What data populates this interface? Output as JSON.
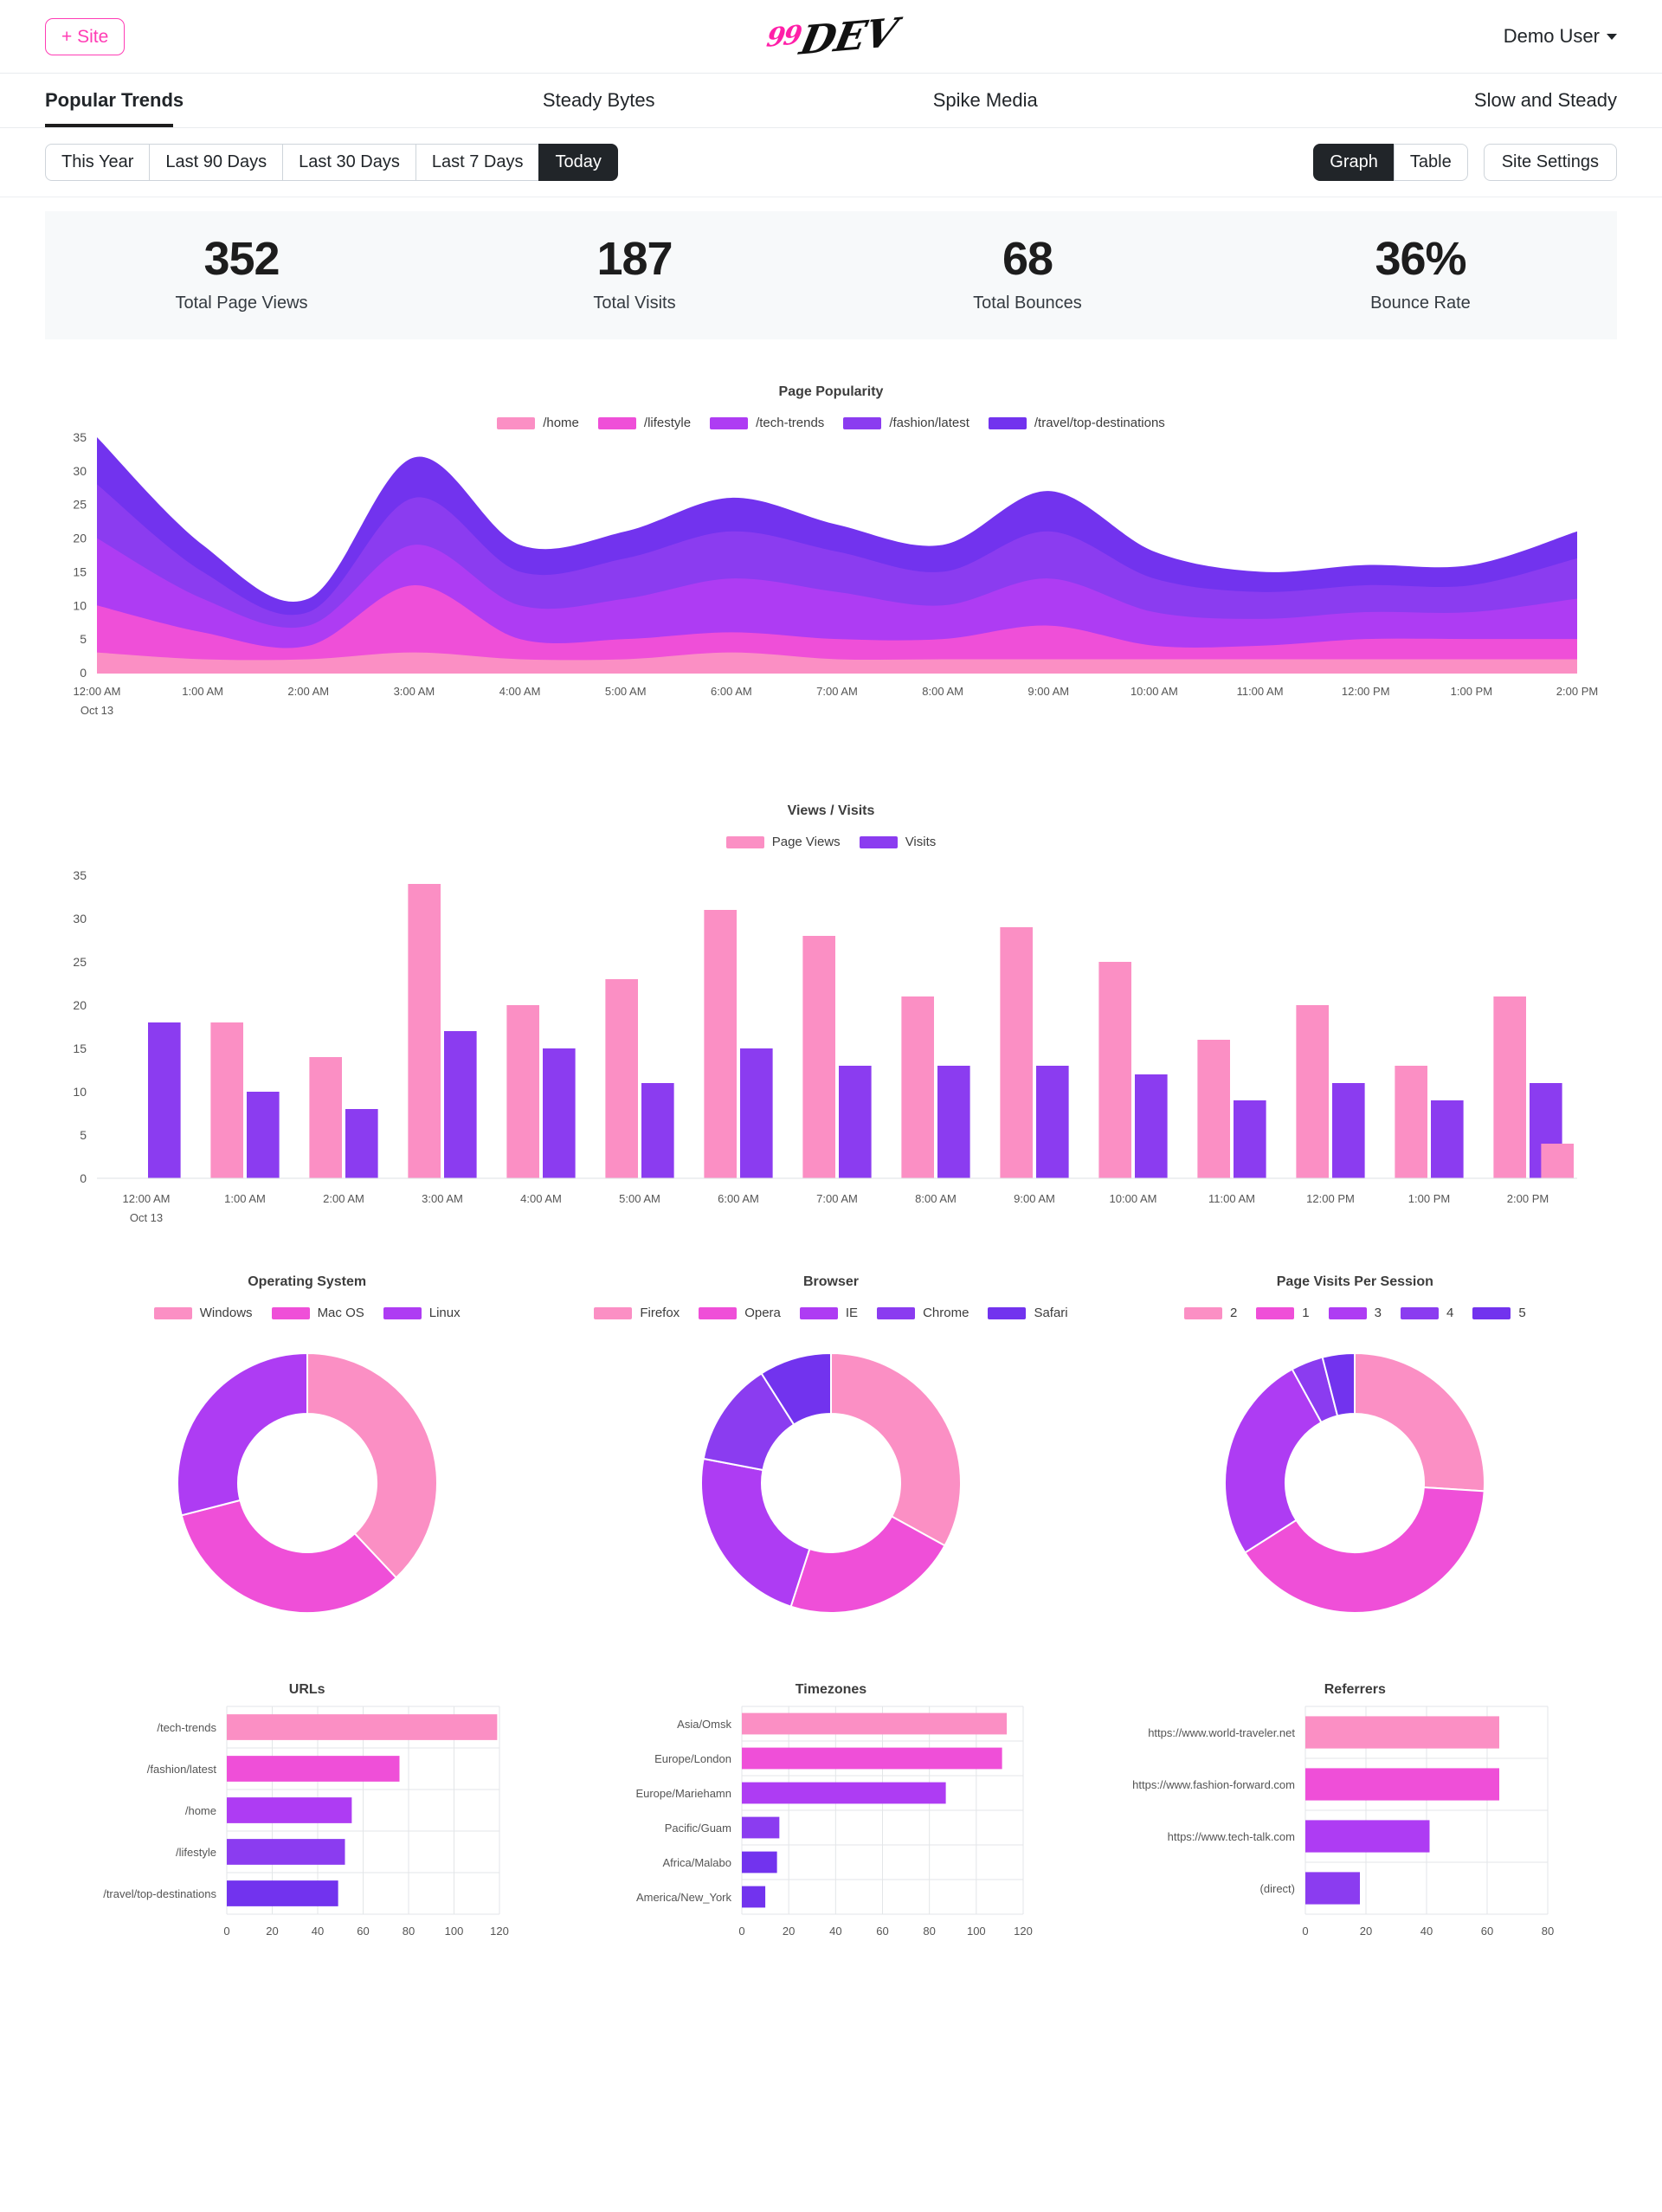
{
  "topbar": {
    "add_site_label": "+ Site",
    "brand_prefix": "99",
    "brand_main": "DEV",
    "user_label": "Demo User"
  },
  "site_tabs": [
    {
      "label": "Popular Trends",
      "active": true
    },
    {
      "label": "Steady Bytes",
      "active": false
    },
    {
      "label": "Spike Media",
      "active": false
    },
    {
      "label": "Slow and Steady",
      "active": false
    }
  ],
  "controls": {
    "ranges": [
      {
        "label": "This Year",
        "active": false
      },
      {
        "label": "Last 90 Days",
        "active": false
      },
      {
        "label": "Last 30 Days",
        "active": false
      },
      {
        "label": "Last 7 Days",
        "active": false
      },
      {
        "label": "Today",
        "active": true
      }
    ],
    "views": [
      {
        "label": "Graph",
        "active": true
      },
      {
        "label": "Table",
        "active": false
      }
    ],
    "settings_label": "Site Settings"
  },
  "kpis": [
    {
      "value": "352",
      "label": "Total Page Views"
    },
    {
      "value": "187",
      "label": "Total Visits"
    },
    {
      "value": "68",
      "label": "Total Bounces"
    },
    {
      "value": "36%",
      "label": "Bounce Rate"
    }
  ],
  "palette": {
    "pink": "#FB8FC4",
    "magenta": "#EF4FD8",
    "violet": "#AE3CF3",
    "purple": "#8B3CF0",
    "indigo": "#7233EE"
  },
  "chart_data": [
    {
      "type": "area",
      "title": "Page Popularity",
      "stacked": true,
      "xlabel": "",
      "ylabel": "",
      "ylim": [
        0,
        35
      ],
      "yticks": [
        0,
        5,
        10,
        15,
        20,
        25,
        30,
        35
      ],
      "x": [
        "12:00 AM",
        "1:00 AM",
        "2:00 AM",
        "3:00 AM",
        "4:00 AM",
        "5:00 AM",
        "6:00 AM",
        "7:00 AM",
        "8:00 AM",
        "9:00 AM",
        "10:00 AM",
        "11:00 AM",
        "12:00 PM",
        "1:00 PM",
        "2:00 PM"
      ],
      "x_sublabel": "Oct 13",
      "legend_position": "top",
      "series": [
        {
          "name": "/home",
          "color": "#FB8FC4",
          "values": [
            3,
            2,
            2,
            3,
            2,
            2,
            3,
            2,
            2,
            2,
            2,
            2,
            2,
            2,
            2
          ]
        },
        {
          "name": "/lifestyle",
          "color": "#EF4FD8",
          "values": [
            7,
            4,
            2,
            10,
            3,
            3,
            3,
            3,
            3,
            5,
            2,
            2,
            3,
            3,
            3
          ]
        },
        {
          "name": "/tech-trends",
          "color": "#AE3CF3",
          "values": [
            10,
            5,
            3,
            6,
            5,
            6,
            8,
            7,
            5,
            7,
            5,
            4,
            4,
            4,
            6
          ]
        },
        {
          "name": "/fashion/latest",
          "color": "#8B3CF0",
          "values": [
            8,
            4,
            2,
            7,
            5,
            6,
            7,
            6,
            5,
            7,
            5,
            4,
            4,
            4,
            6
          ]
        },
        {
          "name": "/travel/top-destinations",
          "color": "#7233EE",
          "values": [
            7,
            4,
            2,
            6,
            4,
            4,
            5,
            4,
            4,
            6,
            4,
            3,
            3,
            3,
            4
          ]
        }
      ]
    },
    {
      "type": "bar",
      "title": "Views / Visits",
      "ylim": [
        0,
        35
      ],
      "yticks": [
        0,
        5,
        10,
        15,
        20,
        25,
        30,
        35
      ],
      "categories": [
        "12:00 AM",
        "1:00 AM",
        "2:00 AM",
        "3:00 AM",
        "4:00 AM",
        "5:00 AM",
        "6:00 AM",
        "7:00 AM",
        "8:00 AM",
        "9:00 AM",
        "10:00 AM",
        "11:00 AM",
        "12:00 PM",
        "1:00 PM",
        "2:00 PM"
      ],
      "x_sublabel": "Oct 13",
      "series": [
        {
          "name": "Page Views",
          "color": "#FB8FC4",
          "values": [
            null,
            18,
            14,
            34,
            20,
            23,
            31,
            28,
            21,
            29,
            25,
            16,
            20,
            13,
            21
          ]
        },
        {
          "name": "Visits",
          "color": "#8B3CF0",
          "values": [
            18,
            10,
            8,
            17,
            15,
            11,
            15,
            13,
            13,
            13,
            12,
            9,
            11,
            9,
            11
          ]
        }
      ],
      "trailing_bar": {
        "name": "Page Views",
        "value": 4
      }
    },
    {
      "type": "pie",
      "title": "Operating System",
      "donut": true,
      "labels": [
        "Windows",
        "Mac OS",
        "Linux"
      ],
      "values": [
        38,
        33,
        29
      ],
      "colors": [
        "#FB8FC4",
        "#EF4FD8",
        "#AE3CF3"
      ]
    },
    {
      "type": "pie",
      "title": "Browser",
      "donut": true,
      "labels": [
        "Firefox",
        "Opera",
        "IE",
        "Chrome",
        "Safari"
      ],
      "values": [
        33,
        22,
        23,
        13,
        9
      ],
      "colors": [
        "#FB8FC4",
        "#EF4FD8",
        "#AE3CF3",
        "#8B3CF0",
        "#7233EE"
      ]
    },
    {
      "type": "pie",
      "title": "Page Visits Per Session",
      "donut": true,
      "labels": [
        "2",
        "1",
        "3",
        "4",
        "5"
      ],
      "values": [
        26,
        40,
        26,
        4,
        4
      ],
      "colors": [
        "#FB8FC4",
        "#EF4FD8",
        "#AE3CF3",
        "#8B3CF0",
        "#7233EE"
      ]
    },
    {
      "type": "bar",
      "orientation": "horizontal",
      "title": "URLs",
      "xlim": [
        0,
        120
      ],
      "xticks": [
        0,
        20,
        40,
        60,
        80,
        100,
        120
      ],
      "categories": [
        "/tech-trends",
        "/fashion/latest",
        "/home",
        "/lifestyle",
        "/travel/top-destinations"
      ],
      "values": [
        119,
        76,
        55,
        52,
        49
      ],
      "colors": [
        "#FB8FC4",
        "#EF4FD8",
        "#AE3CF3",
        "#8B3CF0",
        "#7233EE"
      ]
    },
    {
      "type": "bar",
      "orientation": "horizontal",
      "title": "Timezones",
      "xlim": [
        0,
        120
      ],
      "xticks": [
        0,
        20,
        40,
        60,
        80,
        100,
        120
      ],
      "categories": [
        "Asia/Omsk",
        "Europe/London",
        "Europe/Mariehamn",
        "Pacific/Guam",
        "Africa/Malabo",
        "America/New_York"
      ],
      "values": [
        113,
        111,
        87,
        16,
        15,
        10
      ],
      "colors": [
        "#FB8FC4",
        "#EF4FD8",
        "#AE3CF3",
        "#8B3CF0",
        "#7233EE",
        "#7233EE"
      ]
    },
    {
      "type": "bar",
      "orientation": "horizontal",
      "title": "Referrers",
      "xlim": [
        0,
        80
      ],
      "xticks": [
        0,
        20,
        40,
        60,
        80
      ],
      "categories": [
        "https://www.world-traveler.net",
        "https://www.fashion-forward.com",
        "https://www.tech-talk.com",
        "(direct)"
      ],
      "values": [
        64,
        64,
        41,
        18
      ],
      "colors": [
        "#FB8FC4",
        "#EF4FD8",
        "#AE3CF3",
        "#8B3CF0"
      ]
    }
  ]
}
